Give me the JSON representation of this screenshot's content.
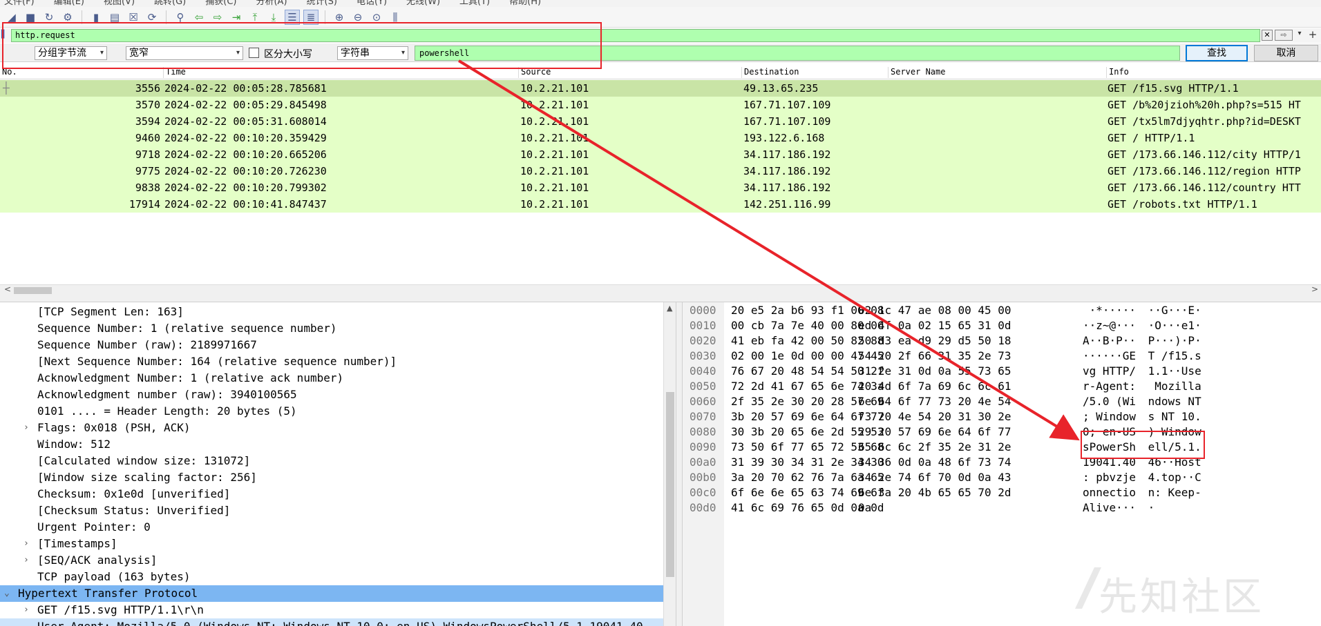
{
  "menubar": {
    "items": [
      "文件(F)",
      "编辑(E)",
      "视图(V)",
      "跳转(G)",
      "捕获(C)",
      "分析(A)",
      "统计(S)",
      "电话(Y)",
      "无线(W)",
      "工具(T)",
      "帮助(H)"
    ]
  },
  "toolbar": {
    "icons": [
      "shark-fin-start-icon",
      "stop-icon",
      "restart-icon",
      "capture-options-icon",
      "open-file-icon",
      "save-file-icon",
      "close-file-icon",
      "reload-icon",
      "find-packet-icon",
      "go-back-icon",
      "go-forward-icon",
      "go-to-packet-icon",
      "go-first-icon",
      "go-last-icon",
      "autoscroll-icon",
      "colorize-icon",
      "zoom-in-icon",
      "zoom-out-icon",
      "zoom-reset-icon",
      "resize-columns-icon"
    ]
  },
  "filter": {
    "value": "http.request"
  },
  "find": {
    "search_in": "分组字节流",
    "char_width": "宽窄",
    "case_label": "区分大小写",
    "search_type": "字符串",
    "search_value": "powershell",
    "find_label": "查找",
    "cancel_label": "取消"
  },
  "packet_list": {
    "columns": [
      "No.",
      "Time",
      "Source",
      "Destination",
      "Server Name",
      "Info"
    ],
    "rows": [
      {
        "no": "3556",
        "time": "2024-02-22 00:05:28.785681",
        "src": "10.2.21.101",
        "dst": "49.13.65.235",
        "server": "",
        "info": "GET /f15.svg HTTP/1.1"
      },
      {
        "no": "3570",
        "time": "2024-02-22 00:05:29.845498",
        "src": "10.2.21.101",
        "dst": "167.71.107.109",
        "server": "",
        "info": "GET /b%20jzioh%20h.php?s=515 HT"
      },
      {
        "no": "3594",
        "time": "2024-02-22 00:05:31.608014",
        "src": "10.2.21.101",
        "dst": "167.71.107.109",
        "server": "",
        "info": "GET /tx5lm7djyqhtr.php?id=DESKT"
      },
      {
        "no": "9460",
        "time": "2024-02-22 00:10:20.359429",
        "src": "10.2.21.101",
        "dst": "193.122.6.168",
        "server": "",
        "info": "GET / HTTP/1.1"
      },
      {
        "no": "9718",
        "time": "2024-02-22 00:10:20.665206",
        "src": "10.2.21.101",
        "dst": "34.117.186.192",
        "server": "",
        "info": "GET /173.66.146.112/city HTTP/1"
      },
      {
        "no": "9775",
        "time": "2024-02-22 00:10:20.726230",
        "src": "10.2.21.101",
        "dst": "34.117.186.192",
        "server": "",
        "info": "GET /173.66.146.112/region HTTP"
      },
      {
        "no": "9838",
        "time": "2024-02-22 00:10:20.799302",
        "src": "10.2.21.101",
        "dst": "34.117.186.192",
        "server": "",
        "info": "GET /173.66.146.112/country HTT"
      },
      {
        "no": "17914",
        "time": "2024-02-22 00:10:41.847437",
        "src": "10.2.21.101",
        "dst": "142.251.116.99",
        "server": "",
        "info": "GET /robots.txt HTTP/1.1"
      }
    ]
  },
  "details": {
    "rows": [
      {
        "text": "[TCP Segment Len: 163]",
        "exp": ""
      },
      {
        "text": "Sequence Number: 1    (relative sequence number)",
        "exp": ""
      },
      {
        "text": "Sequence Number (raw): 2189971667",
        "exp": ""
      },
      {
        "text": "[Next Sequence Number: 164    (relative sequence number)]",
        "exp": ""
      },
      {
        "text": "Acknowledgment Number: 1    (relative ack number)",
        "exp": ""
      },
      {
        "text": "Acknowledgment number (raw): 3940100565",
        "exp": ""
      },
      {
        "text": "0101 .... = Header Length: 20 bytes (5)",
        "exp": ""
      },
      {
        "text": "Flags: 0x018 (PSH, ACK)",
        "exp": ">"
      },
      {
        "text": "Window: 512",
        "exp": ""
      },
      {
        "text": "[Calculated window size: 131072]",
        "exp": ""
      },
      {
        "text": "[Window size scaling factor: 256]",
        "exp": ""
      },
      {
        "text": "Checksum: 0x1e0d [unverified]",
        "exp": ""
      },
      {
        "text": "[Checksum Status: Unverified]",
        "exp": ""
      },
      {
        "text": "Urgent Pointer: 0",
        "exp": ""
      },
      {
        "text": "[Timestamps]",
        "exp": ">"
      },
      {
        "text": "[SEQ/ACK analysis]",
        "exp": ">"
      },
      {
        "text": "TCP payload (163 bytes)",
        "exp": ""
      },
      {
        "text": "Hypertext Transfer Protocol",
        "exp": "v"
      },
      {
        "text": "GET /f15.svg HTTP/1.1\\r\\n",
        "exp": ">"
      },
      {
        "text": "User-Agent: Mozilla/5.0 (Windows NT; Windows NT 10.0; en-US) WindowsPowerShell/5.1.19041.40",
        "exp": ""
      }
    ]
  },
  "bytes": {
    "rows": [
      {
        "off": "0000",
        "h1": "20 e5 2a b6 93 f1 00 08",
        "h2": "02 1c 47 ae 08 00 45 00",
        "a1": " ·*·····",
        "a2": " ··G···E·"
      },
      {
        "off": "0010",
        "h1": "00 cb 7a 7e 40 00 80 06",
        "h2": "ed 4f 0a 02 15 65 31 0d",
        "a1": "··z~@···",
        "a2": " ·O···e1·"
      },
      {
        "off": "0020",
        "h1": "41 eb fa 42 00 50 82 88",
        "h2": "50 d3 ea d9 29 d5 50 18",
        "a1": "A··B·P··",
        "a2": " P···)·P·"
      },
      {
        "off": "0030",
        "h1": "02 00 1e 0d 00 00 47 45",
        "h2": "54 20 2f 66 31 35 2e 73",
        "a1": "······GE",
        "a2": " T /f15.s"
      },
      {
        "off": "0040",
        "h1": "76 67 20 48 54 54 50 2f",
        "h2": "31 2e 31 0d 0a 55 73 65",
        "a1": "vg HTTP/",
        "a2": " 1.1··Use"
      },
      {
        "off": "0050",
        "h1": "72 2d 41 67 65 6e 74 3a",
        "h2": "20 4d 6f 7a 69 6c 6c 61",
        "a1": "r-Agent:",
        "a2": "  Mozilla"
      },
      {
        "off": "0060",
        "h1": "2f 35 2e 30 20 28 57 69",
        "h2": "6e 64 6f 77 73 20 4e 54",
        "a1": "/5.0 (Wi",
        "a2": " ndows NT"
      },
      {
        "off": "0070",
        "h1": "3b 20 57 69 6e 64 6f 77",
        "h2": "73 20 4e 54 20 31 30 2e",
        "a1": "; Window",
        "a2": " s NT 10."
      },
      {
        "off": "0080",
        "h1": "30 3b 20 65 6e 2d 55 53",
        "h2": "29 20 57 69 6e 64 6f 77",
        "a1": "0; en-US",
        "a2": " ) Window"
      },
      {
        "off": "0090",
        "h1": "73 50 6f 77 65 72 53 68",
        "h2": "65 6c 6c 2f 35 2e 31 2e",
        "a1": "sPowerSh",
        "a2": " ell/5.1."
      },
      {
        "off": "00a0",
        "h1": "31 39 30 34 31 2e 34 30",
        "h2": "34 36 0d 0a 48 6f 73 74",
        "a1": "19041.40",
        "a2": " 46··Host"
      },
      {
        "off": "00b0",
        "h1": "3a 20 70 62 76 7a 6a 65",
        "h2": "34 2e 74 6f 70 0d 0a 43",
        "a1": ": pbvzje",
        "a2": " 4.top··C"
      },
      {
        "off": "00c0",
        "h1": "6f 6e 6e 65 63 74 69 6f",
        "h2": "6e 3a 20 4b 65 65 70 2d",
        "a1": "onnectio",
        "a2": " n: Keep-"
      },
      {
        "off": "00d0",
        "h1": "41 6c 69 76 65 0d 0a 0d",
        "h2": "0a",
        "a1": "Alive···",
        "a2": " ·"
      }
    ]
  },
  "watermark": {
    "text": "先知社区"
  },
  "colors": {
    "filter_ok": "#afffaf",
    "row_http": "#e4ffc7",
    "row_selected": "#c9e4a6",
    "details_highlight": "#7cb6f2",
    "annotation": "#e8232a"
  }
}
